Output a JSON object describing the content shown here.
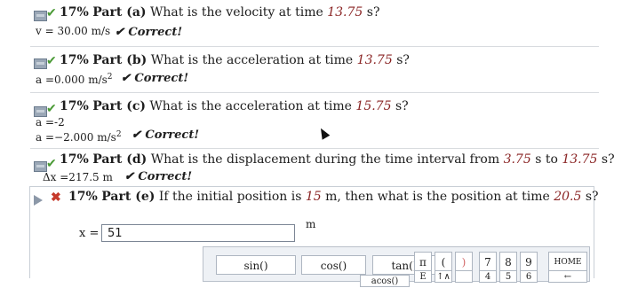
{
  "parts": [
    {
      "percent": "17%",
      "label": "Part (a)",
      "q_prefix": "What is the velocity at time",
      "q_value": "13.75",
      "q_unit": "s?",
      "answer_lines": [
        "v = 30.00 m/s"
      ],
      "status": "Correct!"
    },
    {
      "percent": "17%",
      "label": "Part (b)",
      "q_prefix": "What is the acceleration at time",
      "q_value": "13.75",
      "q_unit": "s?",
      "answer_lines": [
        "a =0.000 m/s"
      ],
      "status": "Correct!"
    },
    {
      "percent": "17%",
      "label": "Part (c)",
      "q_prefix": "What is the acceleration at time",
      "q_value": "15.75",
      "q_unit": "s?",
      "answer_lines": [
        "a =-2",
        "a =−2.000 m/s"
      ],
      "status": "Correct!"
    },
    {
      "percent": "17%",
      "label": "Part (d)",
      "q_prefix": "What is the displacement during the time interval from",
      "q_value": "3.75",
      "q_mid": "s to",
      "q_value2": "13.75",
      "q_unit": "s?",
      "answer_lines": [
        "Δx =217.5 m"
      ],
      "status": "Correct!"
    },
    {
      "percent": "17%",
      "label": "Part (e)",
      "q_prefix": "If the initial position is",
      "q_value": "15",
      "q_mid": "m, then what is the position at time",
      "q_value2": "20.5",
      "q_unit": "s?"
    }
  ],
  "active_input": {
    "label": "x =",
    "value": "51",
    "unit": "m"
  },
  "keypad": {
    "row1": [
      "sin()",
      "cos()",
      "tan()",
      "π",
      "(",
      ")",
      "7",
      "8",
      "9",
      "HOME"
    ],
    "row2": [
      "",
      "",
      "acos()",
      "E",
      "↑∧",
      "",
      "4",
      "5",
      "6",
      "←"
    ]
  },
  "icons": {
    "status": "status-icon",
    "check": "check-badge-icon",
    "arrow": "expand-arrow-icon",
    "x": "incorrect-badge-icon"
  }
}
